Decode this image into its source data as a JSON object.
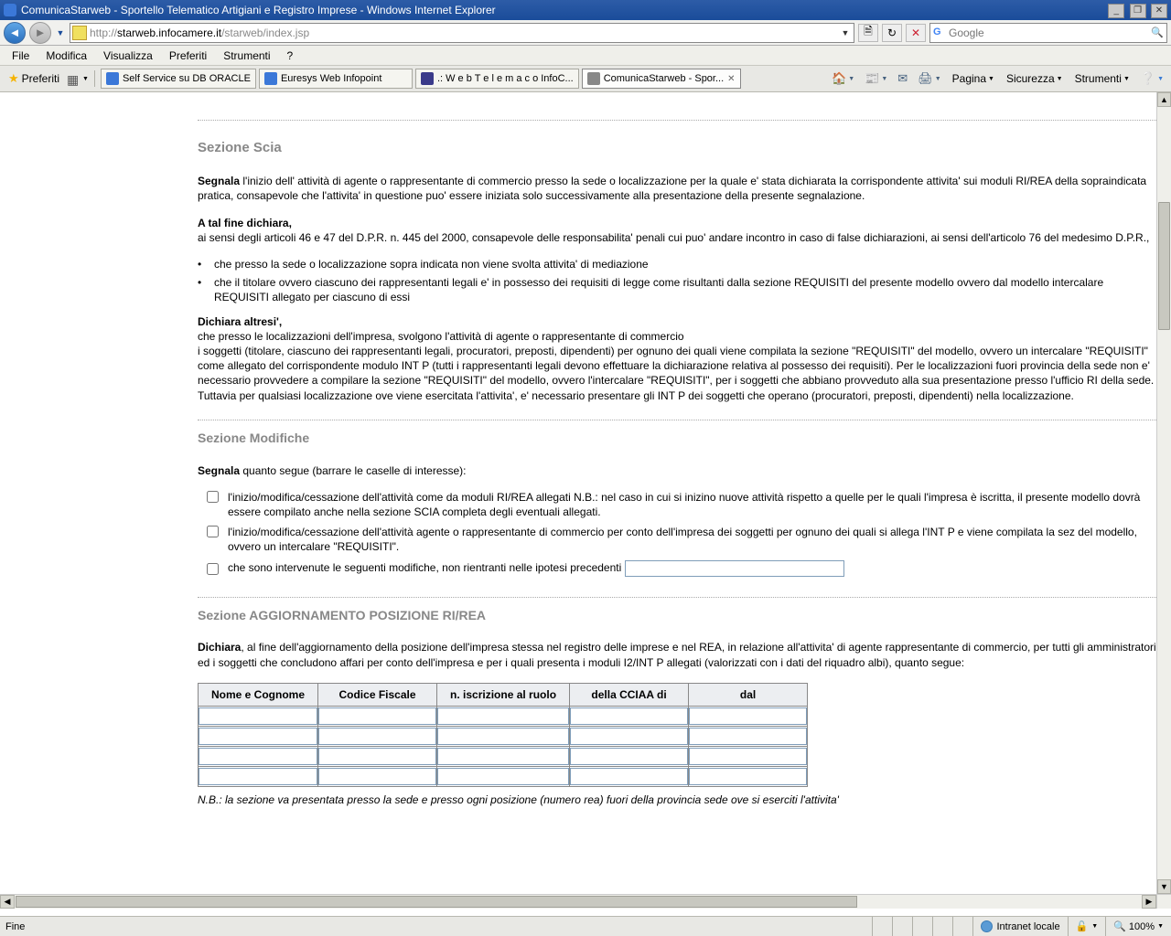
{
  "window": {
    "title": "ComunicaStarweb - Sportello Telematico Artigiani e Registro Imprese - Windows Internet Explorer"
  },
  "address": {
    "prefix": "http://",
    "host": "starweb.infocamere.it",
    "path": "/starweb/index.jsp"
  },
  "search": {
    "placeholder": "Google"
  },
  "menu": {
    "file": "File",
    "modifica": "Modifica",
    "visualizza": "Visualizza",
    "preferiti": "Preferiti",
    "strumenti": "Strumenti",
    "help": "?"
  },
  "fav_label": "Preferiti",
  "tabs": [
    {
      "label": "Self Service su DB ORACLE"
    },
    {
      "label": "Euresys Web Infopoint"
    },
    {
      "label": ".: W e b T e l e m a c o InfoC..."
    },
    {
      "label": "ComunicaStarweb - Spor..."
    }
  ],
  "toolbar_menus": {
    "pagina": "Pagina",
    "sicurezza": "Sicurezza",
    "strumenti": "Strumenti"
  },
  "section_scia_title": "Sezione Scia",
  "scia_segnala_bold": "Segnala",
  "scia_segnala_rest": " l'inizio dell' attività di agente o rappresentante di commercio presso la sede o localizzazione per la quale e' stata dichiarata la corrispondente attivita' sui moduli RI/REA della sopraindicata pratica, consapevole che l'attivita' in questione puo' essere iniziata solo successivamente alla presentazione della presente segnalazione.",
  "scia_atalfine": "A tal fine dichiara,",
  "scia_line1": "ai sensi degli articoli 46 e 47 del D.P.R. n. 445 del 2000, consapevole delle responsabilita' penali cui puo' andare incontro in caso di false dichiarazioni, ai sensi dell'articolo 76 del medesimo D.P.R.,",
  "scia_b1": "che presso la sede o localizzazione sopra indicata non viene svolta attivita' di mediazione",
  "scia_b2": "che il titolare ovvero ciascuno dei rappresentanti legali e' in possesso dei requisiti di legge come risultanti dalla sezione REQUISITI del presente modello ovvero dal modello intercalare REQUISITI allegato per ciascuno di essi",
  "scia_dichiara_altresi": "Dichiara altresi',",
  "scia_altresi_body": "che presso le localizzazioni dell'impresa, svolgono l'attività di agente o rappresentante di commercio\ni soggetti (titolare, ciascuno dei rappresentanti legali, procuratori, preposti, dipendenti) per ognuno dei quali viene compilata la sezione \"REQUISITI\" del modello, ovvero un intercalare \"REQUISITI\" come allegato del corrispondente modulo INT P (tutti i rappresentanti legali devono effettuare la dichiarazione relativa al possesso dei requisiti). Per le localizzazioni fuori provincia della sede non e' necessario provvedere a compilare la sezione \"REQUISITI\" del modello, ovvero l'intercalare \"REQUISITI\", per i soggetti che abbiano provveduto alla sua presentazione presso l'ufficio RI della sede. Tuttavia per qualsiasi localizzazione ove viene esercitata l'attivita', e' necessario presentare gli INT P dei soggetti che operano (procuratori, preposti, dipendenti) nella localizzazione.",
  "section_modifiche_title": "Sezione Modifiche",
  "mod_segnala_bold": "Segnala",
  "mod_segnala_rest": " quanto segue (barrare le caselle di interesse):",
  "mod_chk1": "l'inizio/modifica/cessazione dell'attività come da moduli RI/REA allegati N.B.: nel caso in cui si inizino nuove attività rispetto a quelle per le quali l'impresa è iscritta, il presente modello dovrà essere compilato anche nella sezione SCIA completa degli eventuali allegati.",
  "mod_chk2": "l'inizio/modifica/cessazione dell'attività agente o rappresentante di commercio per conto dell'impresa dei soggetti per ognuno dei quali si allega l'INT P e viene compilata la sez del modello, ovvero un intercalare \"REQUISITI\".",
  "mod_chk3": "che sono intervenute le seguenti modifiche, non rientranti nelle ipotesi precedenti",
  "section_agg_title": "Sezione AGGIORNAMENTO POSIZIONE RI/REA",
  "agg_dichiara_bold": "Dichiara",
  "agg_dichiara_rest": ", al fine dell'aggiornamento della posizione dell'impresa stessa nel registro delle imprese e nel REA, in relazione all'attivita' di agente rappresentante di commercio, per tutti gli amministratori ed i soggetti che concludono affari per conto dell'impresa e per i quali presenta i moduli I2/INT P allegati (valorizzati con i dati del riquadro albi), quanto segue:",
  "table": {
    "h1": "Nome e Cognome",
    "h2": "Codice Fiscale",
    "h3": "n. iscrizione al ruolo",
    "h4": "della CCIAA di",
    "h5": "dal"
  },
  "nb_text": "N.B.: la sezione va presentata presso la sede e presso ogni posizione (numero rea) fuori della provincia sede ove si eserciti l'attivita'",
  "status": {
    "left": "Fine",
    "zone": "Intranet locale",
    "zoom": "100%"
  }
}
